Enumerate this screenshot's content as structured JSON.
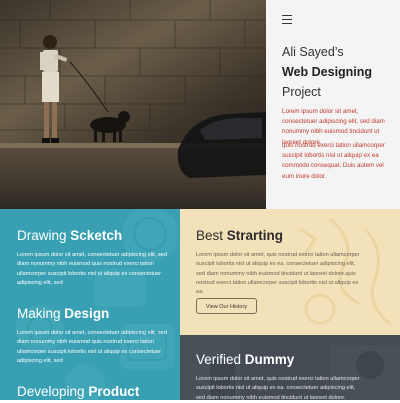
{
  "header": {
    "menu_icon": "hamburger-menu-icon",
    "title_line1": "Ali Sayed’s",
    "title_line2": "Web Designing",
    "title_line3": "Project",
    "paragraph1": "Lorem ipsum dolor sit amet, consectetuer adipiscing elit, sed diam nonummy nibh euismod tincidunt ut laoreet dolore.",
    "paragraph2": "quis nostrud exerci tation ullamcorper suscipit lobortis nisl ut aliquip ex ea commodo consequat. Duis autem vel eum iriure dolor."
  },
  "features": [
    {
      "title_light": "Drawing",
      "title_bold": "Scketch",
      "text": "Lorem ipsum dolor sit amet, consectetuer adipiscing elit, sed diam nonummy nibh euismod quis nostrud exerci tation ullamcorper suscipit lobortis nisl ut aliquip ex consectetuer adipiscing elit, sed"
    },
    {
      "title_light": "Making",
      "title_bold": "Design",
      "text": "Lorem ipsum dolor sit amet, consectetuer adipiscing elit, sed diam nonummy nibh euismod quis nostrud exerci tation ullamcorper suscipit lobortis nisl ut aliquip ex consectetuer adipiscing elit, sed"
    },
    {
      "title_light": "Developing",
      "title_bold": "Product",
      "text": ""
    }
  ],
  "starting": {
    "title_light": "Best",
    "title_bold": "Strarting",
    "text": "Lorem ipsum dolor sit amet, quis nostrud exerci tation ullamcorper suscipit lobortis nisl ut aliquip ex ea. consectetuer adipiscing elit, sed diam nonummy nibh euismod tincidunt ut laoreet dolore.quis nostrud exerci tation ullamcorper suscipit lobortis nisl ut aliquip ex ea.",
    "button_label": "View Our History"
  },
  "verified": {
    "title_light": "Verified",
    "title_bold": "Dummy",
    "text": "Lorem ipsum dolor sit amet, quis nostrud exerci tation ullamcorper suscipit lobortis nisl ut aliquip ex ea. consectetuer adipiscing elit, sed diam nonummy nibh euismod tincidunt ut laoreet dolore."
  },
  "colors": {
    "teal": "#3aa2b4",
    "beige": "#f3e2b9",
    "dark": "#545b63",
    "intro_text": "#c0392b"
  }
}
